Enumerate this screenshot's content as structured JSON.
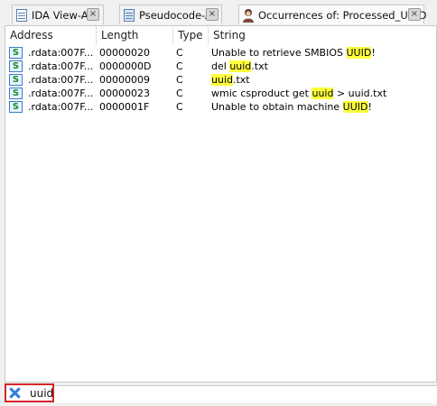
{
  "tabs": [
    {
      "label": "IDA View-A",
      "icon": "table-icon",
      "close": "×"
    },
    {
      "label": "Pseudocode-A",
      "icon": "table-icon",
      "close": "×"
    },
    {
      "label": "Occurrences of: Processed_UUID",
      "icon": "portrait-icon",
      "close": "×"
    }
  ],
  "columns": {
    "address": "Address",
    "length": "Length",
    "type": "Type",
    "string": "String"
  },
  "rows": [
    {
      "icon": "S",
      "address": ".rdata:007F...",
      "length": "00000020",
      "type": "C",
      "pre": "Unable to retrieve SMBIOS ",
      "match": "UUID",
      "post": "!"
    },
    {
      "icon": "S",
      "address": ".rdata:007F...",
      "length": "0000000D",
      "type": "C",
      "pre": "del ",
      "match": "uuid",
      "post": ".txt"
    },
    {
      "icon": "S",
      "address": ".rdata:007F...",
      "length": "00000009",
      "type": "C",
      "pre": "",
      "match": "uuid",
      "post": ".txt"
    },
    {
      "icon": "S",
      "address": ".rdata:007F...",
      "length": "00000023",
      "type": "C",
      "pre": "wmic csproduct get ",
      "match": "uuid",
      "post": " > uuid.txt"
    },
    {
      "icon": "S",
      "address": ".rdata:007F...",
      "length": "0000001F",
      "type": "C",
      "pre": "Unable to obtain machine ",
      "match": "UUID",
      "post": "!"
    }
  ],
  "filter": {
    "value": "uuid",
    "clear_icon": "close-filter-icon"
  },
  "colors": {
    "highlight": "#ffff3d",
    "filter_border": "#d9252a",
    "clear_icon": "#2f7de0"
  }
}
